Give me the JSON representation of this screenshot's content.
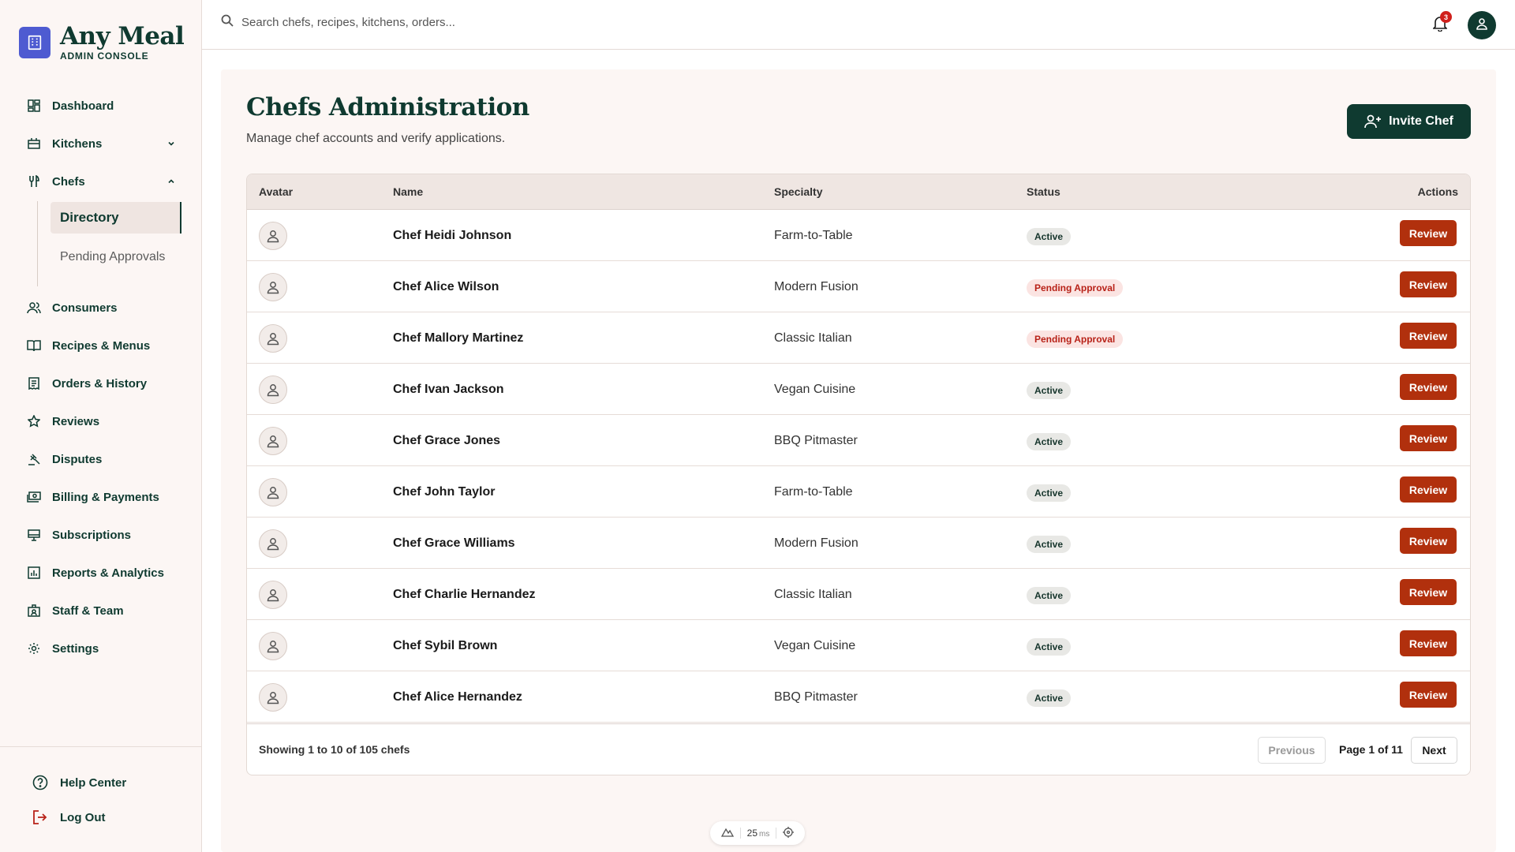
{
  "brand": {
    "name": "Any Meal",
    "subtitle": "ADMIN CONSOLE"
  },
  "sidebar": {
    "items": [
      {
        "label": "Dashboard",
        "icon": "dashboard-icon"
      },
      {
        "label": "Kitchens",
        "icon": "kitchen-icon",
        "expandable": true,
        "expanded": false
      },
      {
        "label": "Chefs",
        "icon": "utensils-icon",
        "expandable": true,
        "expanded": true
      },
      {
        "label": "Consumers",
        "icon": "users-icon"
      },
      {
        "label": "Recipes & Menus",
        "icon": "book-icon"
      },
      {
        "label": "Orders & History",
        "icon": "receipt-icon"
      },
      {
        "label": "Reviews",
        "icon": "star-icon"
      },
      {
        "label": "Disputes",
        "icon": "gavel-icon"
      },
      {
        "label": "Billing & Payments",
        "icon": "payments-icon"
      },
      {
        "label": "Subscriptions",
        "icon": "monitor-icon"
      },
      {
        "label": "Reports & Analytics",
        "icon": "chart-icon"
      },
      {
        "label": "Staff & Team",
        "icon": "badge-icon"
      },
      {
        "label": "Settings",
        "icon": "gear-icon"
      }
    ],
    "chefs_sub": [
      {
        "label": "Directory",
        "active": true
      },
      {
        "label": "Pending Approvals",
        "active": false
      }
    ],
    "bottom": [
      {
        "label": "Help Center",
        "icon": "help-icon"
      },
      {
        "label": "Log Out",
        "icon": "logout-icon"
      }
    ]
  },
  "topbar": {
    "search_placeholder": "Search chefs, recipes, kitchens, orders...",
    "notification_count": "3"
  },
  "page": {
    "title": "Chefs Administration",
    "subtitle": "Manage chef accounts and verify applications.",
    "invite_label": "Invite Chef"
  },
  "table": {
    "columns": [
      "Avatar",
      "Name",
      "Specialty",
      "Status",
      "Actions"
    ],
    "action_label": "Review",
    "rows": [
      {
        "name": "Chef Heidi Johnson",
        "specialty": "Farm-to-Table",
        "status": "Active"
      },
      {
        "name": "Chef Alice Wilson",
        "specialty": "Modern Fusion",
        "status": "Pending Approval"
      },
      {
        "name": "Chef Mallory Martinez",
        "specialty": "Classic Italian",
        "status": "Pending Approval"
      },
      {
        "name": "Chef Ivan Jackson",
        "specialty": "Vegan Cuisine",
        "status": "Active"
      },
      {
        "name": "Chef Grace Jones",
        "specialty": "BBQ Pitmaster",
        "status": "Active"
      },
      {
        "name": "Chef John Taylor",
        "specialty": "Farm-to-Table",
        "status": "Active"
      },
      {
        "name": "Chef Grace Williams",
        "specialty": "Modern Fusion",
        "status": "Active"
      },
      {
        "name": "Chef Charlie Hernandez",
        "specialty": "Classic Italian",
        "status": "Active"
      },
      {
        "name": "Chef Sybil Brown",
        "specialty": "Vegan Cuisine",
        "status": "Active"
      },
      {
        "name": "Chef Alice Hernandez",
        "specialty": "BBQ Pitmaster",
        "status": "Active"
      }
    ],
    "showing": "Showing 1 to 10 of 105 chefs",
    "prev_label": "Previous",
    "page_info": "Page 1 of 11",
    "next_label": "Next"
  },
  "perf": {
    "value": "25",
    "unit": "ms"
  },
  "colors": {
    "primary": "#0f3a30",
    "action": "#b1300d",
    "pending": "#b82218",
    "logo": "#4e5bd1"
  }
}
